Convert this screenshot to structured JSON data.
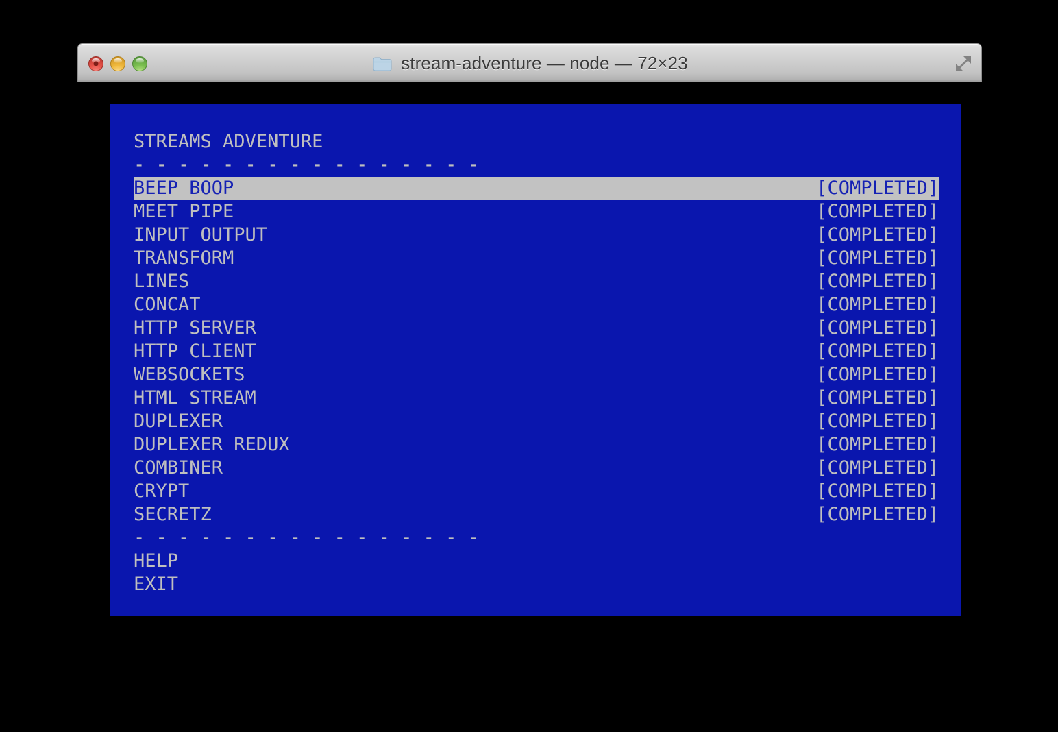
{
  "window": {
    "title": "stream-adventure — node — 72×23",
    "title_icon": "folder-icon",
    "controls": {
      "close_label": "close",
      "minimize_label": "minimize",
      "zoom_label": "zoom",
      "fullscreen_label": "fullscreen"
    }
  },
  "terminal": {
    "background_color": "#0A16AE",
    "foreground_color": "#BFBFBF",
    "selection_background": "#C2C2C2",
    "selection_foreground": "#1521B4",
    "heading": "STREAMS ADVENTURE",
    "separator_top": "- - - - - - - - - - - - - - - -",
    "separator_bottom": "- - - - - - - - - - - - - - - -",
    "status_completed": "[COMPLETED]",
    "items": [
      {
        "label": "BEEP BOOP",
        "status": "[COMPLETED]",
        "selected": true
      },
      {
        "label": "MEET PIPE",
        "status": "[COMPLETED]",
        "selected": false
      },
      {
        "label": "INPUT OUTPUT",
        "status": "[COMPLETED]",
        "selected": false
      },
      {
        "label": "TRANSFORM",
        "status": "[COMPLETED]",
        "selected": false
      },
      {
        "label": "LINES",
        "status": "[COMPLETED]",
        "selected": false
      },
      {
        "label": "CONCAT",
        "status": "[COMPLETED]",
        "selected": false
      },
      {
        "label": "HTTP SERVER",
        "status": "[COMPLETED]",
        "selected": false
      },
      {
        "label": "HTTP CLIENT",
        "status": "[COMPLETED]",
        "selected": false
      },
      {
        "label": "WEBSOCKETS",
        "status": "[COMPLETED]",
        "selected": false
      },
      {
        "label": "HTML STREAM",
        "status": "[COMPLETED]",
        "selected": false
      },
      {
        "label": "DUPLEXER",
        "status": "[COMPLETED]",
        "selected": false
      },
      {
        "label": "DUPLEXER REDUX",
        "status": "[COMPLETED]",
        "selected": false
      },
      {
        "label": "COMBINER",
        "status": "[COMPLETED]",
        "selected": false
      },
      {
        "label": "CRYPT",
        "status": "[COMPLETED]",
        "selected": false
      },
      {
        "label": "SECRETZ",
        "status": "[COMPLETED]",
        "selected": false
      }
    ],
    "menu": [
      {
        "label": "HELP"
      },
      {
        "label": "EXIT"
      }
    ]
  }
}
